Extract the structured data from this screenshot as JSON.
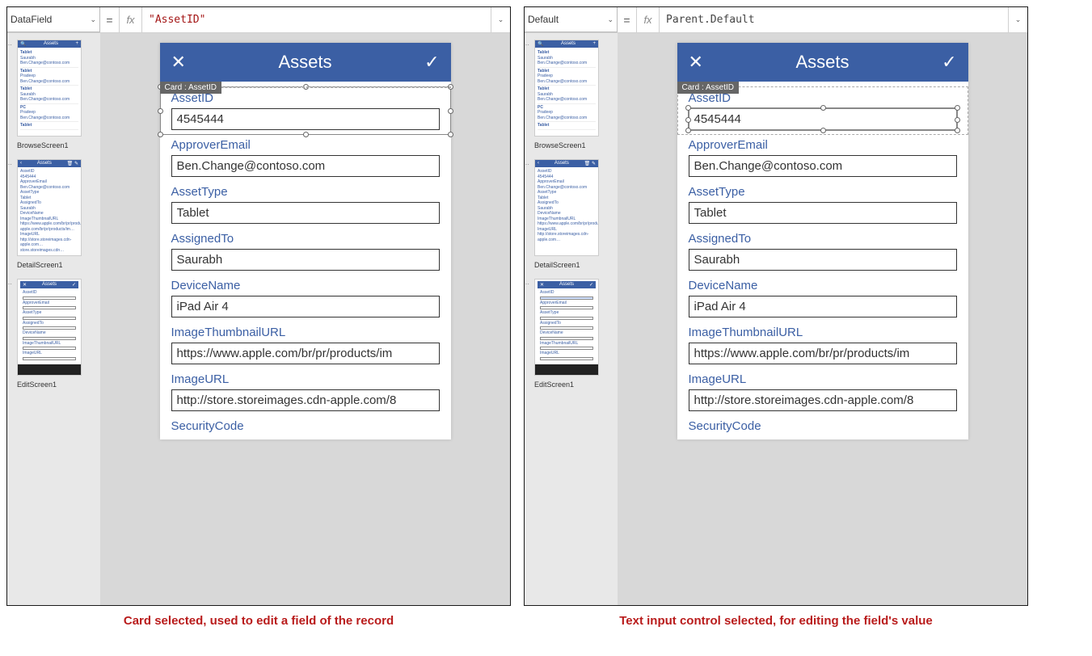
{
  "left": {
    "property": "DataField",
    "formula": "\"AssetID\"",
    "card_tag": "Card : AssetID",
    "selection_mode": "card"
  },
  "right": {
    "property": "Default",
    "formula": "Parent.Default",
    "card_tag": "Card : AssetID",
    "selection_mode": "input"
  },
  "fx_label": "fx",
  "eq": "=",
  "app_header": {
    "title": "Assets",
    "cancel": "✕",
    "accept": "✓"
  },
  "screens": {
    "browse": "BrowseScreen1",
    "detail": "DetailScreen1",
    "edit": "EditScreen1",
    "thumb_title": "Assets"
  },
  "form_fields": [
    {
      "label": "AssetID",
      "value": "4545444"
    },
    {
      "label": "ApproverEmail",
      "value": "Ben.Change@contoso.com"
    },
    {
      "label": "AssetType",
      "value": "Tablet"
    },
    {
      "label": "AssignedTo",
      "value": "Saurabh"
    },
    {
      "label": "DeviceName",
      "value": "iPad Air 4"
    },
    {
      "label": "ImageThumbnailURL",
      "value": "https://www.apple.com/br/pr/products/im"
    },
    {
      "label": "ImageURL",
      "value": "http://store.storeimages.cdn-apple.com/8"
    },
    {
      "label": "SecurityCode",
      "value": ""
    }
  ],
  "captions": {
    "left": "Card selected, used to edit a field of the record",
    "right": "Text input control selected, for editing the field's value"
  }
}
